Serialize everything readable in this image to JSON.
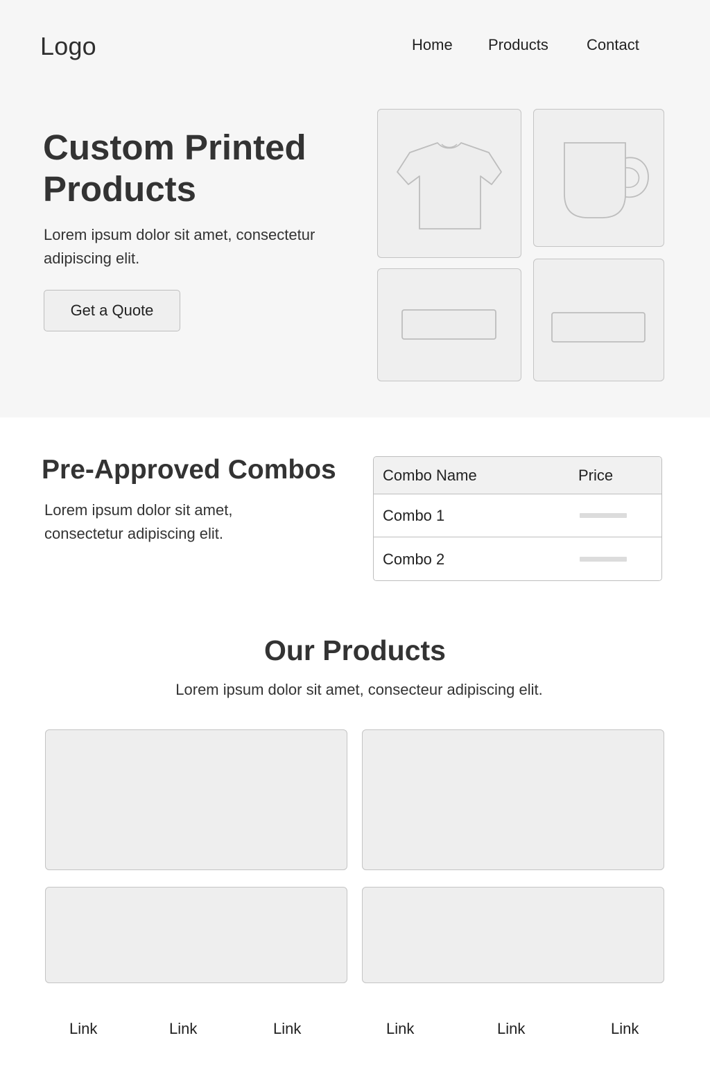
{
  "header": {
    "logo": "Logo",
    "nav": [
      {
        "label": "Home"
      },
      {
        "label": "Products"
      },
      {
        "label": "Contact"
      }
    ]
  },
  "hero": {
    "title_line1": "Custom Printed",
    "title_line2": "Products",
    "text": "Lorem ipsum dolor sit amet, consectetur adipiscing elit.",
    "cta_label": "Get a Quote",
    "tiles": [
      {
        "icon": "t-shirt-icon"
      },
      {
        "icon": "mug-icon"
      },
      {
        "icon": "label-icon"
      },
      {
        "icon": "label-icon"
      }
    ]
  },
  "combos": {
    "title": "Pre-Approved Combos",
    "text": "Lorem ipsum dolor sit amet, consectetur adipiscing elit.",
    "table": {
      "headers": [
        "Combo Name",
        "Price"
      ],
      "rows": [
        {
          "name": "Combo 1",
          "price": ""
        },
        {
          "name": "Combo 2",
          "price": ""
        }
      ]
    }
  },
  "products": {
    "title": "Our Products",
    "text": "Lorem ipsum dolor sit amet, consecteur adipiscing elit."
  },
  "footer": {
    "links": [
      "Link",
      "Link",
      "Link",
      "Link",
      "Link",
      "Link"
    ]
  },
  "colors": {
    "hero_background": "#f6f6f6",
    "placeholder_fill": "#efefef",
    "border": "#c4c4c4",
    "text": "#2e2e2e"
  }
}
